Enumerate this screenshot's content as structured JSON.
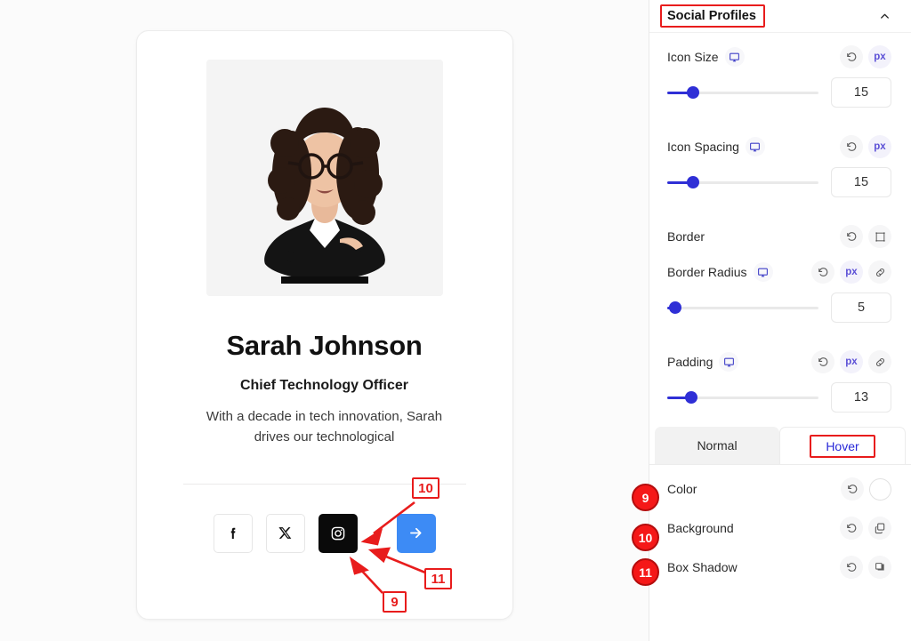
{
  "preview": {
    "card": {
      "name": "Sarah Johnson",
      "role": "Chief Technology Officer",
      "bio": "With a decade in tech innovation, Sarah drives our technological",
      "photo_alt": "portrait-photo",
      "socials": [
        {
          "name": "facebook",
          "glyph": "f",
          "state": "normal"
        },
        {
          "name": "x-twitter",
          "glyph": "X",
          "state": "normal"
        },
        {
          "name": "instagram",
          "glyph": "instagram",
          "state": "hover"
        },
        {
          "name": "arrow-cta",
          "glyph": "arrow-right",
          "state": "cta"
        }
      ]
    }
  },
  "panel": {
    "title": "Social Profiles",
    "collapse_icon": "chevron-up-icon",
    "controls": [
      {
        "label": "Icon Size",
        "device_icon": "desktop-icon",
        "actions": [
          "reset-icon",
          "px"
        ],
        "value": "15",
        "percent": 17
      },
      {
        "label": "Icon Spacing",
        "device_icon": "desktop-icon",
        "actions": [
          "reset-icon",
          "px"
        ],
        "value": "15",
        "percent": 17
      }
    ],
    "border": {
      "label": "Border",
      "actions": [
        "reset-icon",
        "border-icon"
      ]
    },
    "border_radius": {
      "label": "Border Radius",
      "device_icon": "desktop-icon",
      "actions": [
        "reset-icon",
        "px",
        "link-icon"
      ],
      "value": "5",
      "percent": 5
    },
    "padding": {
      "label": "Padding",
      "device_icon": "desktop-icon",
      "actions": [
        "reset-icon",
        "px",
        "link-icon"
      ],
      "value": "13",
      "percent": 16
    },
    "tabs": [
      {
        "label": "Normal",
        "active": false
      },
      {
        "label": "Hover",
        "active": true
      }
    ],
    "state_rows": [
      {
        "badge": "9",
        "label": "Color",
        "reset": "reset-icon",
        "control": "color-swatch"
      },
      {
        "badge": "10",
        "label": "Background",
        "reset": "reset-icon",
        "control": "layers-icon"
      },
      {
        "badge": "11",
        "label": "Box Shadow",
        "reset": "reset-icon",
        "control": "square-icon"
      }
    ]
  },
  "annotations": {
    "boxes": [
      {
        "id": "10",
        "label": "10"
      },
      {
        "id": "11",
        "label": "11"
      },
      {
        "id": "9",
        "label": "9"
      }
    ],
    "highlight_color": "#e81c1c",
    "badge_color": "#f51818"
  },
  "colors": {
    "accent_blue": "#2f2fd6",
    "cta_blue": "#3d8bf5",
    "unit_purple": "#5b4fd6",
    "tab_active_text": "#2828d8"
  }
}
